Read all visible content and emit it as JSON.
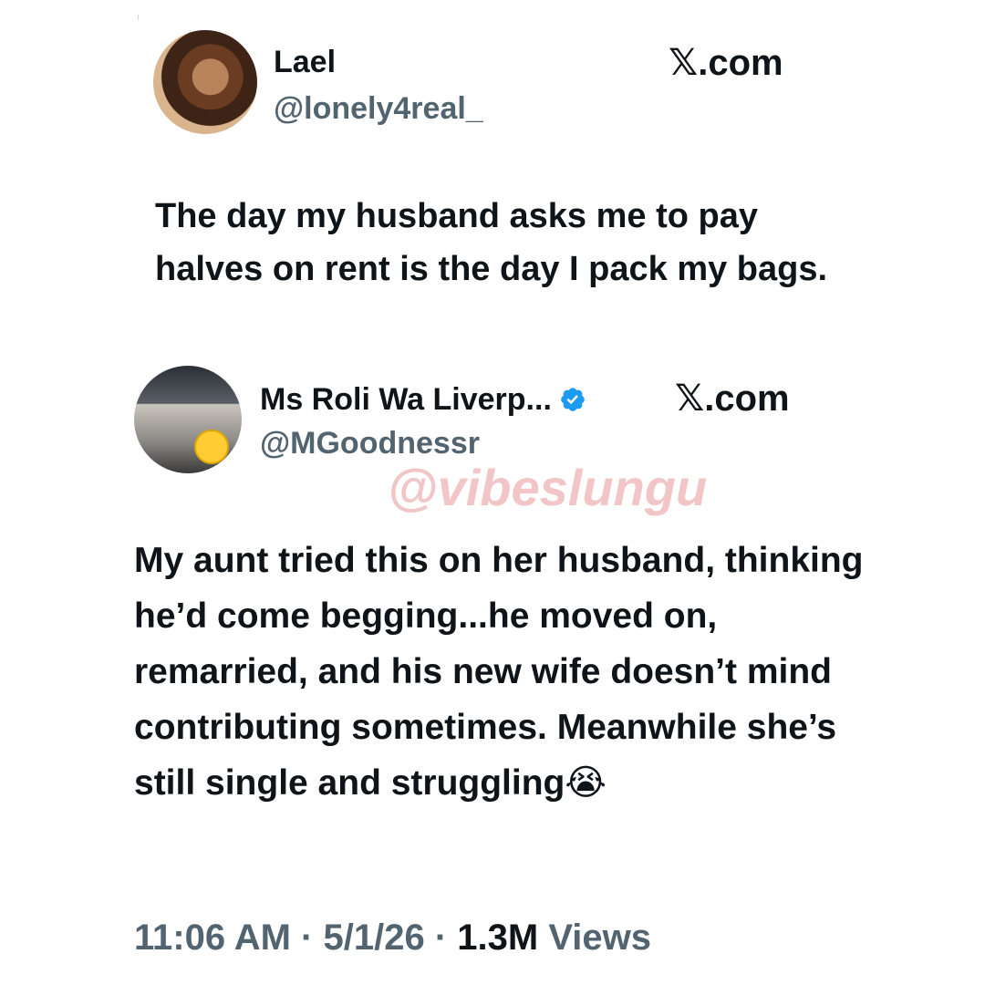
{
  "tweet1": {
    "name": "Lael",
    "handle": "@lonely4real_",
    "site": "𝕏.com",
    "text": "The day my husband asks me to pay halves on rent is the day I pack my bags."
  },
  "tweet2": {
    "name": "Ms Roli Wa Liverp...",
    "handle": "@MGoodnessr",
    "site": "𝕏.com",
    "verified": true,
    "text": "My aunt tried this on her husband, thinking he’d come begging...he moved on, remarried, and his new wife doesn’t mind contributing sometimes. Meanwhile she’s still single and struggling😭"
  },
  "watermark": "@vibeslungu",
  "footer": {
    "time": "11:06 AM",
    "separator": " · ",
    "date": "5/1/26",
    "views_count": "1.3M",
    "views_label": "Views"
  },
  "colors": {
    "text": "#0f1419",
    "secondary": "#536471",
    "verified_blue": "#1d9bf0",
    "watermark": "#f2c6c6"
  }
}
